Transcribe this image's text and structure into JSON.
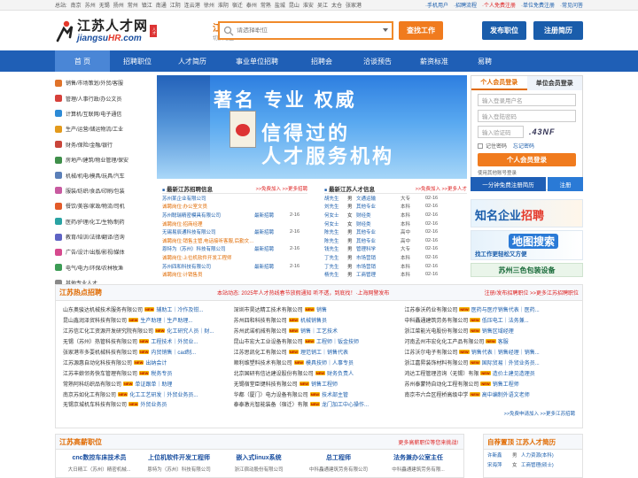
{
  "topbar": {
    "cities": [
      "总站:",
      "南京",
      "苏州",
      "无锡",
      "扬州",
      "常州",
      "镇江",
      "南通",
      "江阴",
      "连云港",
      "徐州",
      "淮阴",
      "宿迁",
      "泰州",
      "常熟",
      "盐城",
      "昆山",
      "淮安",
      "吴江",
      "太仓",
      "张家港"
    ],
    "links": [
      "·手机用户",
      "·招聘流程",
      "·个人免费注册",
      "·单位免费注册",
      "·常见问答"
    ]
  },
  "header": {
    "logo_cn": "江苏人才网",
    "logo_en_prefix": "jiangsu",
    "logo_en_hr": "HR",
    "logo_en_suffix": ".com",
    "logo_seal": "人才",
    "region_name": "江苏",
    "region_switch": "切换地区›",
    "search_placeholder": "请选择职位",
    "find_btn": "查找工作",
    "post_btn": "发布职位",
    "reg_btn": "注册简历"
  },
  "nav": {
    "items": [
      "首 页",
      "招聘职位",
      "人才简历",
      "事业单位招聘",
      "招聘会",
      "洽谈预告",
      "薪资标准",
      "易聘"
    ]
  },
  "categories": [
    {
      "label": "销售/市场策划/外贸/客服",
      "color": "#e0732a"
    },
    {
      "label": "管理/人事行政/办公文员",
      "color": "#d6403a"
    },
    {
      "label": "计算机/互联网/电子通信",
      "color": "#2c8ad6"
    },
    {
      "label": "生产/运营/储运物流/工业",
      "color": "#e39a1c"
    },
    {
      "label": "财务/保险/金融/银行",
      "color": "#c9453a"
    },
    {
      "label": "房地产/建筑/物业管理/保安",
      "color": "#3f8f4a"
    },
    {
      "label": "机械/机电/模具/玩具/汽车",
      "color": "#5a7fb8"
    },
    {
      "label": "服装/纺织/食品/印刷/包装",
      "color": "#c85aa0"
    },
    {
      "label": "餐饮/美容/家政/物流/司机",
      "color": "#e35b29"
    },
    {
      "label": "医药/护理/化工/生物/制药",
      "color": "#2aa3a3"
    },
    {
      "label": "教育/培训/法律/翻译/咨询",
      "color": "#5e63c4"
    },
    {
      "label": "广告/设计/出版/影视/媒体",
      "color": "#d64a8e"
    },
    {
      "label": "电气/电力/环保/农林牧渔",
      "color": "#3c9c55"
    },
    {
      "label": "其他专业人才",
      "color": "#888888"
    }
  ],
  "banner": {
    "line1": "著名  专业  权威",
    "line2": "信得过的",
    "line3": "人才服务机构"
  },
  "login": {
    "tab_person": "个人会员登录",
    "tab_company": "单位会员登录",
    "username_placeholder": "输入登录用户名",
    "password_placeholder": "输入登陆密码",
    "captcha_placeholder": "输入验证码",
    "captcha_code": ".43NF",
    "remember": "记住密码",
    "forgot": "忘记密码",
    "login_btn": "个人会员登录",
    "other_login": "使用其他账号登录"
  },
  "regbar": {
    "left": "一分钟免费注册简历",
    "right": "注册"
  },
  "ads": {
    "ad1_a": "知名企业",
    "ad1_b": "招聘",
    "ad2_title": "地图搜索",
    "ad2_sub": "找工作更轻松又方便",
    "ad3": "苏州三色包装设备"
  },
  "list_jobs": {
    "title": "最新江苏招聘信息",
    "more": ">>免费加入 >>更多招聘",
    "rows": [
      {
        "company": "苏州某企业有限公司",
        "tag": "",
        "date": ""
      },
      {
        "company": "诚聘岗位:办公室文员",
        "tag": "",
        "date": "",
        "sub": true
      },
      {
        "company": "苏州聪瑞精密模具有限公司",
        "tag": "最新招聘",
        "date": "2-16"
      },
      {
        "company": "诚聘岗位:招商经理",
        "tag": "",
        "date": "",
        "sub": true
      },
      {
        "company": "无锡易辰通科技有限公司",
        "tag": "最新招聘",
        "date": "2-16"
      },
      {
        "company": "诚聘岗位:销售主管,电话接听客服,后勤文员,人事主管",
        "tag": "",
        "date": "",
        "sub": true
      },
      {
        "company": "恩特为（苏州）科技有限公司",
        "tag": "最新招聘",
        "date": "2-16"
      },
      {
        "company": "诚聘岗位:上位机软件开发工程师",
        "tag": "",
        "date": "",
        "sub": true
      },
      {
        "company": "苏州四和科技有限公司",
        "tag": "最新招聘",
        "date": "2-16"
      },
      {
        "company": "诚聘岗位:计销售员",
        "tag": "",
        "date": "",
        "sub": true
      }
    ]
  },
  "list_talents": {
    "title": "最新江苏人才信息",
    "more": ">>免费加入 >>更多人才",
    "rows": [
      {
        "name": "胡先生",
        "gender": "男",
        "job": "文通运输",
        "edu": "大专",
        "date": "02-16"
      },
      {
        "name": "刘先生",
        "gender": "男",
        "job": "其他专业",
        "edu": "本科",
        "date": "02-16"
      },
      {
        "name": "何女士",
        "gender": "女",
        "job": "财经类",
        "edu": "本科",
        "date": "02-16"
      },
      {
        "name": "何女士",
        "gender": "女",
        "job": "财经类",
        "edu": "本科",
        "date": "02-16"
      },
      {
        "name": "陈先生",
        "gender": "男",
        "job": "其他专业",
        "edu": "高中",
        "date": "02-16"
      },
      {
        "name": "陈先生",
        "gender": "男",
        "job": "其他专业",
        "edu": "高中",
        "date": "02-16"
      },
      {
        "name": "钱先生",
        "gender": "男",
        "job": "管理科学",
        "edu": "大专",
        "date": "02-16"
      },
      {
        "name": "丁先生",
        "gender": "男",
        "job": "市场营销",
        "edu": "本科",
        "date": "02-16"
      },
      {
        "name": "丁先生",
        "gender": "男",
        "job": "市场营销",
        "edu": "本科",
        "date": "02-16"
      },
      {
        "name": "杨先生",
        "gender": "男",
        "job": "工商管理",
        "edu": "本科",
        "date": "02-16"
      }
    ]
  },
  "hot": {
    "title": "江苏热点招聘",
    "marquee": "本站动态: 2025年人才热线春节放假通知 听不透，到底找！·上海网警发布",
    "right": "注册/发布招聘职位 >>更多江苏招聘职位",
    "columns": [
      [
        {
          "company": "山东奥骏达机械技术服务有限公司",
          "job": "辅助工｜冷作及钳..."
        },
        {
          "company": "昆山鑫润泽贸科技有限公司",
          "job": "生产助理｜生产助理..."
        },
        {
          "company": "江苏信汇化工资源开发研究院有限公司",
          "job": "化工研究人员｜财..."
        },
        {
          "company": "无锡（苏州）热管科技有限公司",
          "job": "工程技术｜外贸业..."
        },
        {
          "company": "张家港市多耍机械科技有限公司",
          "job": "内贸销售｜cad制..."
        },
        {
          "company": "江苏源惠自动化科技有限公司",
          "job": "出纳会计"
        },
        {
          "company": "江苏丰娘邻务快车管理有限公司",
          "job": "税务专员"
        },
        {
          "company": "常熟阿科纺织品有限公司",
          "job": "单证跟单｜助理"
        },
        {
          "company": "南京苏如化工有限公司",
          "job": "化工工艺研发｜外贸业务员..."
        },
        {
          "company": "无锡京城机车科技有限公司",
          "job": "外贸业务员"
        }
      ],
      [
        {
          "company": "深圳市昊达精工技术有限公司",
          "job": "销售"
        },
        {
          "company": "苏州四和科技有限公司",
          "job": "机械销售员"
        },
        {
          "company": "苏州武诺机械有限公司",
          "job": "销售｜工艺技术"
        },
        {
          "company": "昆山市宏大工业设备有限公司",
          "job": "工程师｜钣金技师"
        },
        {
          "company": "江苏思凯化工有限公司",
          "job": "理范销工｜销售代表"
        },
        {
          "company": "顺利维塑料技术有限公司",
          "job": "模具技师｜人事专员"
        },
        {
          "company": "北京国研有信达建设股份有限公司",
          "job": "财务负责人"
        },
        {
          "company": "无锡宿堂臣键科技有限公司",
          "job": "销售工程师"
        },
        {
          "company": "华都（厦门）电力设备有限公司",
          "job": "技术部主管"
        },
        {
          "company": "泰泰激光智能装备（宿迁）有限",
          "job": "龙门加工中心操作..."
        }
      ],
      [
        {
          "company": "江苏泰沃药业有限公司",
          "job": "医药与医疗销售代表｜医药..."
        },
        {
          "company": "中科矗通建筑劳务有限公司",
          "job": "低压电工｜法务兼..."
        },
        {
          "company": "浙江菜能光电股份有限公司",
          "job": "销售区域经理"
        },
        {
          "company": "河南孟州市宏化化工产品有限公司",
          "job": "客服"
        },
        {
          "company": "江苏沃尔电子有限公司",
          "job": "销售代表｜销售经理｜销售..."
        },
        {
          "company": "浙江嘉昇装饰材料有限公司",
          "job": "国际贸易｜外贸业务员..."
        },
        {
          "company": "鸿达工程管理咨询（无锡）有限",
          "job": "造价土建见造理员"
        },
        {
          "company": "苏州泰蒙特自动化工程有限公司",
          "job": "销售工程师"
        },
        {
          "company": "南京市六合区程桥高级中学",
          "job": "高中编制外语文老师"
        },
        {
          "company": "",
          "job": ""
        }
      ]
    ],
    "foot": ">>免费申请加入  >>更多江苏招聘"
  },
  "hi": {
    "title": "江苏高薪职位",
    "right": "更多高薪职位等您来挑战!",
    "cards": [
      {
        "job": "cnc数控车床技术员",
        "company": "大日精工（苏州）精密机械..."
      },
      {
        "job": "上位机软件开发工程师",
        "company": "恩特为（苏州）科技有限公司"
      },
      {
        "job": "嵌入式linux系统",
        "company": "浙江宿动股份有限公司"
      },
      {
        "job": "总工程师",
        "company": "中科矗通建筑劳务有限公司"
      },
      {
        "job": "法务兼办公室主任",
        "company": "中科矗通建筑劳务有限..."
      }
    ]
  },
  "rec": {
    "title": "自荐置顶 江苏人才简历",
    "rows": [
      {
        "name": "许新鑫",
        "gender": "男",
        "pos": "人力资源(本科)"
      },
      {
        "name": "宋海萍",
        "gender": "女",
        "pos": "工商管理(硕士)"
      }
    ]
  }
}
